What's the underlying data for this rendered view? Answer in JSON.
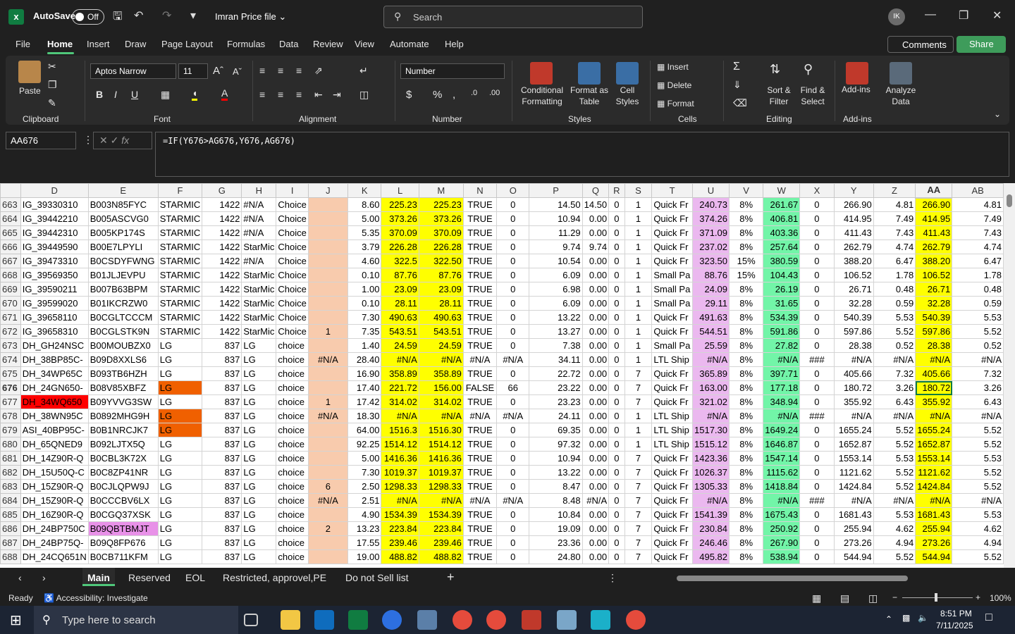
{
  "titlebar": {
    "autosave": "AutoSave",
    "toggle": "Off",
    "filename": "Imran Price file",
    "search_placeholder": "Search",
    "avatar": "IK"
  },
  "menu": {
    "items": [
      "File",
      "Home",
      "Insert",
      "Draw",
      "Page Layout",
      "Formulas",
      "Data",
      "Review",
      "View",
      "Automate",
      "Help"
    ],
    "comments": "Comments",
    "share": "Share"
  },
  "ribbon": {
    "paste": "Paste",
    "clipboard": "Clipboard",
    "font_name": "Aptos Narrow",
    "font_size": "11",
    "font": "Font",
    "alignment": "Alignment",
    "number_format": "Number",
    "number": "Number",
    "cond_format": "Conditional Formatting",
    "format_table": "Format as Table",
    "cell_styles": "Cell Styles",
    "styles": "Styles",
    "insert": "Insert",
    "delete": "Delete",
    "format": "Format",
    "cells": "Cells",
    "sort_filter": "Sort & Filter",
    "find_select": "Find & Select",
    "editing": "Editing",
    "addins": "Add-ins",
    "addins_group": "Add-ins",
    "analyze": "Analyze Data"
  },
  "formula": {
    "name_box": "AA676",
    "fx": "fx",
    "content": "=IF(Y676>AG676,Y676,AG676)"
  },
  "columns": [
    "D",
    "E",
    "F",
    "G",
    "H",
    "I",
    "J",
    "K",
    "L",
    "M",
    "N",
    "O",
    "P",
    "Q",
    "R",
    "S",
    "T",
    "U",
    "V",
    "W",
    "X",
    "Y",
    "Z",
    "AA",
    "AB"
  ],
  "rows": [
    {
      "n": "663",
      "c": [
        "IG_39330310",
        "B003N85FYC",
        "STARMIC",
        "1422",
        "#N/A",
        "Choice",
        "",
        "8.60",
        "225.23",
        "225.23",
        "TRUE",
        "0",
        "14.50",
        "14.50",
        "0",
        "1",
        "Quick Fr",
        "240.73",
        "8%",
        "261.67",
        "0",
        "266.90",
        "4.81",
        "266.90",
        "4.81"
      ]
    },
    {
      "n": "664",
      "c": [
        "IG_39442210",
        "B005ASCVG0",
        "STARMIC",
        "1422",
        "#N/A",
        "Choice",
        "",
        "5.00",
        "373.26",
        "373.26",
        "TRUE",
        "0",
        "10.94",
        "0.00",
        "0",
        "1",
        "Quick Fr",
        "374.26",
        "8%",
        "406.81",
        "0",
        "414.95",
        "7.49",
        "414.95",
        "7.49"
      ]
    },
    {
      "n": "665",
      "c": [
        "IG_39442310",
        "B005KP174S",
        "STARMIC",
        "1422",
        "#N/A",
        "Choice",
        "",
        "5.35",
        "370.09",
        "370.09",
        "TRUE",
        "0",
        "11.29",
        "0.00",
        "0",
        "1",
        "Quick Fr",
        "371.09",
        "8%",
        "403.36",
        "0",
        "411.43",
        "7.43",
        "411.43",
        "7.43"
      ]
    },
    {
      "n": "666",
      "c": [
        "IG_39449590",
        "B00E7LPYLI",
        "STARMIC",
        "1422",
        "StarMic",
        "Choice",
        "",
        "3.79",
        "226.28",
        "226.28",
        "TRUE",
        "0",
        "9.74",
        "9.74",
        "0",
        "1",
        "Quick Fr",
        "237.02",
        "8%",
        "257.64",
        "0",
        "262.79",
        "4.74",
        "262.79",
        "4.74"
      ]
    },
    {
      "n": "667",
      "c": [
        "IG_39473310",
        "B0CSDYFWNG",
        "STARMIC",
        "1422",
        "#N/A",
        "Choice",
        "",
        "4.60",
        "322.5",
        "322.50",
        "TRUE",
        "0",
        "10.54",
        "0.00",
        "0",
        "1",
        "Quick Fr",
        "323.50",
        "15%",
        "380.59",
        "0",
        "388.20",
        "6.47",
        "388.20",
        "6.47"
      ]
    },
    {
      "n": "668",
      "c": [
        "IG_39569350",
        "B01JLJEVPU",
        "STARMIC",
        "1422",
        "StarMic",
        "Choice",
        "",
        "0.10",
        "87.76",
        "87.76",
        "TRUE",
        "0",
        "6.09",
        "0.00",
        "0",
        "1",
        "Small Pa",
        "88.76",
        "15%",
        "104.43",
        "0",
        "106.52",
        "1.78",
        "106.52",
        "1.78"
      ]
    },
    {
      "n": "669",
      "c": [
        "IG_39590211",
        "B007B63BPM",
        "STARMIC",
        "1422",
        "StarMic",
        "Choice",
        "",
        "1.00",
        "23.09",
        "23.09",
        "TRUE",
        "0",
        "6.98",
        "0.00",
        "0",
        "1",
        "Small Pa",
        "24.09",
        "8%",
        "26.19",
        "0",
        "26.71",
        "0.48",
        "26.71",
        "0.48"
      ]
    },
    {
      "n": "670",
      "c": [
        "IG_39599020",
        "B01IKCRZW0",
        "STARMIC",
        "1422",
        "StarMic",
        "Choice",
        "",
        "0.10",
        "28.11",
        "28.11",
        "TRUE",
        "0",
        "6.09",
        "0.00",
        "0",
        "1",
        "Small Pa",
        "29.11",
        "8%",
        "31.65",
        "0",
        "32.28",
        "0.59",
        "32.28",
        "0.59"
      ]
    },
    {
      "n": "671",
      "c": [
        "IG_39658110",
        "B0CGLTCCCM",
        "STARMIC",
        "1422",
        "StarMic",
        "Choice",
        "",
        "7.30",
        "490.63",
        "490.63",
        "TRUE",
        "0",
        "13.22",
        "0.00",
        "0",
        "1",
        "Quick Fr",
        "491.63",
        "8%",
        "534.39",
        "0",
        "540.39",
        "5.53",
        "540.39",
        "5.53"
      ]
    },
    {
      "n": "672",
      "c": [
        "IG_39658310",
        "B0CGLSTK9N",
        "STARMIC",
        "1422",
        "StarMic",
        "Choice",
        "1",
        "7.35",
        "543.51",
        "543.51",
        "TRUE",
        "0",
        "13.27",
        "0.00",
        "0",
        "1",
        "Quick Fr",
        "544.51",
        "8%",
        "591.86",
        "0",
        "597.86",
        "5.52",
        "597.86",
        "5.52"
      ]
    },
    {
      "n": "673",
      "c": [
        "DH_GH24NSC",
        "B00MOUBZX0",
        "LG",
        "837",
        "LG",
        "choice",
        "",
        "1.40",
        "24.59",
        "24.59",
        "TRUE",
        "0",
        "7.38",
        "0.00",
        "0",
        "1",
        "Small Pa",
        "25.59",
        "8%",
        "27.82",
        "0",
        "28.38",
        "0.52",
        "28.38",
        "0.52"
      ]
    },
    {
      "n": "674",
      "c": [
        "DH_38BP85C-",
        "B09D8XXLS6",
        "LG",
        "837",
        "LG",
        "choice",
        "#N/A",
        "28.40",
        "#N/A",
        "#N/A",
        "#N/A",
        "#N/A",
        "34.11",
        "0.00",
        "0",
        "1",
        "LTL Ship",
        "#N/A",
        "8%",
        "#N/A",
        "###",
        "#N/A",
        "#N/A",
        "#N/A",
        "#N/A"
      ]
    },
    {
      "n": "675",
      "c": [
        "DH_34WP65C",
        "B093TB6HZH",
        "LG",
        "837",
        "LG",
        "choice",
        "",
        "16.90",
        "358.89",
        "358.89",
        "TRUE",
        "0",
        "22.72",
        "0.00",
        "0",
        "7",
        "Quick Fr",
        "365.89",
        "8%",
        "397.71",
        "0",
        "405.66",
        "7.32",
        "405.66",
        "7.32"
      ]
    },
    {
      "n": "676",
      "c": [
        "DH_24GN650-",
        "B08V85XBFZ",
        "LG",
        "837",
        "LG",
        "choice",
        "",
        "17.40",
        "221.72",
        "156.00",
        "FALSE",
        "66",
        "23.22",
        "0.00",
        "0",
        "7",
        "Quick Fr",
        "163.00",
        "8%",
        "177.18",
        "0",
        "180.72",
        "3.26",
        "180.72",
        "3.26"
      ]
    },
    {
      "n": "677",
      "c": [
        "DH_34WQ650",
        "B09YVVG3SW",
        "LG",
        "837",
        "LG",
        "choice",
        "1",
        "17.42",
        "314.02",
        "314.02",
        "TRUE",
        "0",
        "23.23",
        "0.00",
        "0",
        "7",
        "Quick Fr",
        "321.02",
        "8%",
        "348.94",
        "0",
        "355.92",
        "6.43",
        "355.92",
        "6.43"
      ]
    },
    {
      "n": "678",
      "c": [
        "DH_38WN95C",
        "B0892MHG9H",
        "LG",
        "837",
        "LG",
        "choice",
        "#N/A",
        "18.30",
        "#N/A",
        "#N/A",
        "#N/A",
        "#N/A",
        "24.11",
        "0.00",
        "0",
        "1",
        "LTL Ship",
        "#N/A",
        "8%",
        "#N/A",
        "###",
        "#N/A",
        "#N/A",
        "#N/A",
        "#N/A"
      ]
    },
    {
      "n": "679",
      "c": [
        "ASI_40BP95C-",
        "B0B1NRCJK7",
        "LG",
        "837",
        "LG",
        "choice",
        "",
        "64.00",
        "1516.3",
        "1516.30",
        "TRUE",
        "0",
        "69.35",
        "0.00",
        "0",
        "1",
        "LTL Ship",
        "1517.30",
        "8%",
        "1649.24",
        "0",
        "1655.24",
        "5.52",
        "1655.24",
        "5.52"
      ]
    },
    {
      "n": "680",
      "c": [
        "DH_65QNED9",
        "B092LJTX5Q",
        "LG",
        "837",
        "LG",
        "choice",
        "",
        "92.25",
        "1514.12",
        "1514.12",
        "TRUE",
        "0",
        "97.32",
        "0.00",
        "0",
        "1",
        "LTL Ship",
        "1515.12",
        "8%",
        "1646.87",
        "0",
        "1652.87",
        "5.52",
        "1652.87",
        "5.52"
      ]
    },
    {
      "n": "681",
      "c": [
        "DH_14Z90R-Q",
        "B0CBL3K72X",
        "LG",
        "837",
        "LG",
        "choice",
        "",
        "5.00",
        "1416.36",
        "1416.36",
        "TRUE",
        "0",
        "10.94",
        "0.00",
        "0",
        "7",
        "Quick Fr",
        "1423.36",
        "8%",
        "1547.14",
        "0",
        "1553.14",
        "5.53",
        "1553.14",
        "5.53"
      ]
    },
    {
      "n": "682",
      "c": [
        "DH_15U50Q-C",
        "B0C8ZP41NR",
        "LG",
        "837",
        "LG",
        "choice",
        "",
        "7.30",
        "1019.37",
        "1019.37",
        "TRUE",
        "0",
        "13.22",
        "0.00",
        "0",
        "7",
        "Quick Fr",
        "1026.37",
        "8%",
        "1115.62",
        "0",
        "1121.62",
        "5.52",
        "1121.62",
        "5.52"
      ]
    },
    {
      "n": "683",
      "c": [
        "DH_15Z90R-Q",
        "B0CJLQPW9J",
        "LG",
        "837",
        "LG",
        "choice",
        "6",
        "2.50",
        "1298.33",
        "1298.33",
        "TRUE",
        "0",
        "8.47",
        "0.00",
        "0",
        "7",
        "Quick Fr",
        "1305.33",
        "8%",
        "1418.84",
        "0",
        "1424.84",
        "5.52",
        "1424.84",
        "5.52"
      ]
    },
    {
      "n": "684",
      "c": [
        "DH_15Z90R-Q",
        "B0CCCBV6LX",
        "LG",
        "837",
        "LG",
        "choice",
        "#N/A",
        "2.51",
        "#N/A",
        "#N/A",
        "#N/A",
        "#N/A",
        "8.48",
        "#N/A",
        "0",
        "7",
        "Quick Fr",
        "#N/A",
        "8%",
        "#N/A",
        "###",
        "#N/A",
        "#N/A",
        "#N/A",
        "#N/A"
      ]
    },
    {
      "n": "685",
      "c": [
        "DH_16Z90R-Q",
        "B0CGQ37XSK",
        "LG",
        "837",
        "LG",
        "choice",
        "",
        "4.90",
        "1534.39",
        "1534.39",
        "TRUE",
        "0",
        "10.84",
        "0.00",
        "0",
        "7",
        "Quick Fr",
        "1541.39",
        "8%",
        "1675.43",
        "0",
        "1681.43",
        "5.53",
        "1681.43",
        "5.53"
      ]
    },
    {
      "n": "686",
      "c": [
        "DH_24BP750C",
        "B09QBTBMJT",
        "LG",
        "837",
        "LG",
        "choice",
        "2",
        "13.23",
        "223.84",
        "223.84",
        "TRUE",
        "0",
        "19.09",
        "0.00",
        "0",
        "7",
        "Quick Fr",
        "230.84",
        "8%",
        "250.92",
        "0",
        "255.94",
        "4.62",
        "255.94",
        "4.62"
      ]
    },
    {
      "n": "687",
      "c": [
        "DH_24BP75Q-",
        "B09Q8FP676",
        "LG",
        "837",
        "LG",
        "choice",
        "",
        "17.55",
        "239.46",
        "239.46",
        "TRUE",
        "0",
        "23.36",
        "0.00",
        "0",
        "7",
        "Quick Fr",
        "246.46",
        "8%",
        "267.90",
        "0",
        "273.26",
        "4.94",
        "273.26",
        "4.94"
      ]
    },
    {
      "n": "688",
      "c": [
        "DH_24CQ651N",
        "B0CB711KFM",
        "LG",
        "837",
        "LG",
        "choice",
        "",
        "19.00",
        "488.82",
        "488.82",
        "TRUE",
        "0",
        "24.80",
        "0.00",
        "0",
        "7",
        "Quick Fr",
        "495.82",
        "8%",
        "538.94",
        "0",
        "544.94",
        "5.52",
        "544.94",
        "5.52"
      ]
    }
  ],
  "sheets": {
    "tabs": [
      "Main",
      "Reserved",
      "EOL",
      "Restricted, approvel,PE",
      "Do not Sell list"
    ],
    "add": "+"
  },
  "status": {
    "ready": "Ready",
    "accessibility": "Accessibility: Investigate",
    "zoom": "100%"
  },
  "taskbar": {
    "search_placeholder": "Type here to search",
    "time": "8:51 PM",
    "date": "7/11/2025"
  }
}
